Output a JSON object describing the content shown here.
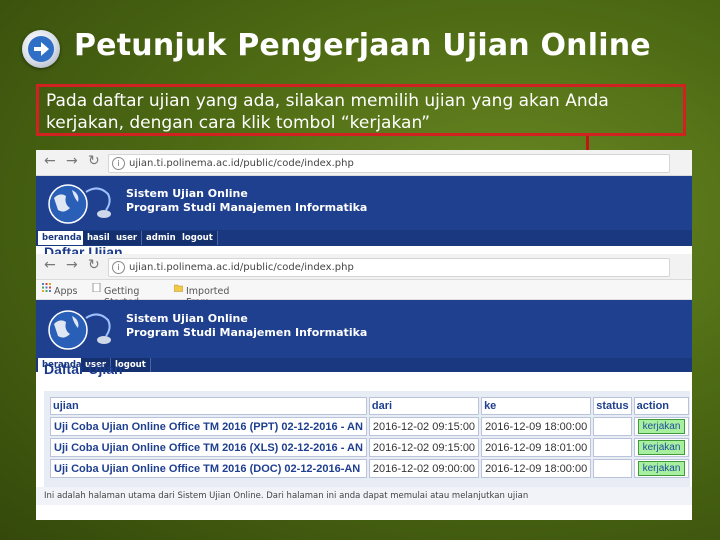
{
  "slide": {
    "title": "Petunjuk Pengerjaan Ujian Online",
    "instruction": "Pada daftar ujian yang ada, silakan memilih ujian yang akan Anda kerjakan, dengan cara klik tombol “kerjakan”",
    "accent_colors": {
      "background": "#4e6b14",
      "highlight_border": "#d12222"
    },
    "arrow_icon": "arrow-right-circle-icon"
  },
  "browser_back": {
    "url": "ujian.ti.polinema.ac.id/public/code/index.php",
    "site_name_line1": "Sistem Ujian Online",
    "site_name_line2": "Program Studi Manajemen Informatika",
    "menu": [
      "beranda",
      "hasil",
      "user",
      "admin",
      "logout"
    ],
    "heading": "Daftar Ujian"
  },
  "browser_front": {
    "url": "ujian.ti.polinema.ac.id/public/code/index.php",
    "bookmarks": [
      "Apps",
      "Getting Started",
      "Imported From Firefox"
    ],
    "site_name_line1": "Sistem Ujian Online",
    "site_name_line2": "Program Studi Manajemen Informatika",
    "menu": [
      "beranda",
      "user",
      "logout"
    ],
    "heading": "Daftar Ujian",
    "table": {
      "headers": [
        "ujian",
        "dari",
        "ke",
        "status",
        "action"
      ],
      "rows": [
        {
          "ujian": "Uji Coba Ujian Online Office TM 2016 (PPT) 02-12-2016 - AN",
          "dari": "2016-12-02 09:15:00",
          "ke": "2016-12-09 18:00:00",
          "status": "",
          "action": "kerjakan"
        },
        {
          "ujian": "Uji Coba Ujian Online Office TM 2016 (XLS) 02-12-2016 - AN",
          "dari": "2016-12-02 09:15:00",
          "ke": "2016-12-09 18:01:00",
          "status": "",
          "action": "kerjakan"
        },
        {
          "ujian": "Uji Coba Ujian Online Office TM 2016 (DOC) 02-12-2016-AN",
          "dari": "2016-12-02 09:00:00",
          "ke": "2016-12-09 18:00:00",
          "status": "",
          "action": "kerjakan"
        }
      ]
    },
    "footer": "Ini adalah halaman utama dari Sistem Ujian Online. Dari halaman ini anda dapat memulai atau melanjutkan ujian"
  }
}
